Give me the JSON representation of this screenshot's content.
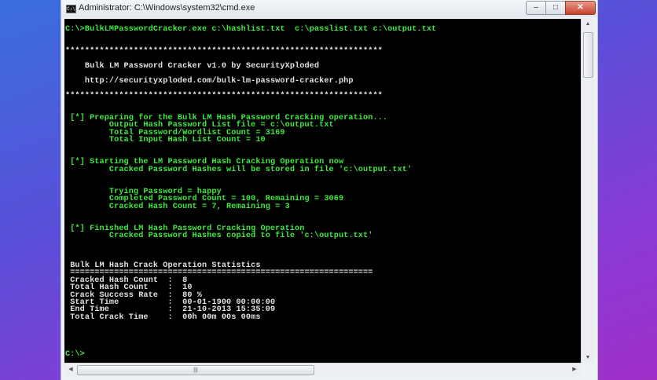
{
  "window": {
    "title": "Administrator: C:\\Windows\\system32\\cmd.exe",
    "icon_label": "C:\\",
    "buttons": {
      "minimize": "–",
      "maximize": "□",
      "close": "✕"
    },
    "scroll_grip": "|||"
  },
  "console": {
    "lines": [
      {
        "text": "C:\\>BulkLMPasswordCracker.exe c:\\hashlist.txt  c:\\passlist.txt c:\\output.txt",
        "color": "g"
      },
      {
        "text": "",
        "color": "w"
      },
      {
        "text": "",
        "color": "w"
      },
      {
        "text": "*****************************************************************",
        "color": "w"
      },
      {
        "text": "",
        "color": "w"
      },
      {
        "text": "    Bulk LM Password Cracker v1.0 by SecurityXploded",
        "color": "w"
      },
      {
        "text": "",
        "color": "w"
      },
      {
        "text": "    http://securityxploded.com/bulk-lm-password-cracker.php",
        "color": "w"
      },
      {
        "text": "",
        "color": "w"
      },
      {
        "text": "*****************************************************************",
        "color": "w"
      },
      {
        "text": "",
        "color": "w"
      },
      {
        "text": "",
        "color": "w"
      },
      {
        "text": " [*] Preparing for the Bulk LM Hash Password Cracking operation...",
        "color": "g"
      },
      {
        "text": "         Output Hash Password List file = c:\\output.txt",
        "color": "g"
      },
      {
        "text": "         Total Password/Wordlist Count = 3169",
        "color": "g"
      },
      {
        "text": "         Total Input Hash List Count = 10",
        "color": "g"
      },
      {
        "text": "",
        "color": "w"
      },
      {
        "text": "",
        "color": "w"
      },
      {
        "text": " [*] Starting the LM Password Hash Cracking Operation now",
        "color": "g"
      },
      {
        "text": "         Cracked Password Hashes will be stored in file 'c:\\output.txt'",
        "color": "g"
      },
      {
        "text": "",
        "color": "w"
      },
      {
        "text": "",
        "color": "w"
      },
      {
        "text": "         Trying Password = happy",
        "color": "g"
      },
      {
        "text": "         Completed Password Count = 100, Remaining = 3069",
        "color": "g"
      },
      {
        "text": "         Cracked Hash Count = 7, Remaining = 3",
        "color": "g"
      },
      {
        "text": "",
        "color": "w"
      },
      {
        "text": "",
        "color": "w"
      },
      {
        "text": " [*] Finished LM Hash Password Cracking Operation",
        "color": "g"
      },
      {
        "text": "         Cracked Password Hashes copied to file 'c:\\output.txt'",
        "color": "g"
      },
      {
        "text": "",
        "color": "w"
      },
      {
        "text": "",
        "color": "w"
      },
      {
        "text": "",
        "color": "w"
      },
      {
        "text": " Bulk LM Hash Crack Operation Statistics",
        "color": "w"
      },
      {
        "text": " ==============================================================",
        "color": "w"
      },
      {
        "text": " Cracked Hash Count  :  8",
        "color": "w"
      },
      {
        "text": " Total Hash Count    :  10",
        "color": "w"
      },
      {
        "text": " Crack Success Rate  :  80 %",
        "color": "w"
      },
      {
        "text": " Start Time          :  00-01-1900 00:00:00",
        "color": "w"
      },
      {
        "text": " End Time            :  21-10-2013 15:35:09",
        "color": "w"
      },
      {
        "text": " Total Crack Time    :  00h 00m 00s 00ms",
        "color": "w"
      },
      {
        "text": "",
        "color": "w"
      },
      {
        "text": "",
        "color": "w"
      },
      {
        "text": "",
        "color": "w"
      },
      {
        "text": "",
        "color": "w"
      },
      {
        "text": "C:\\>",
        "color": "g"
      }
    ]
  }
}
